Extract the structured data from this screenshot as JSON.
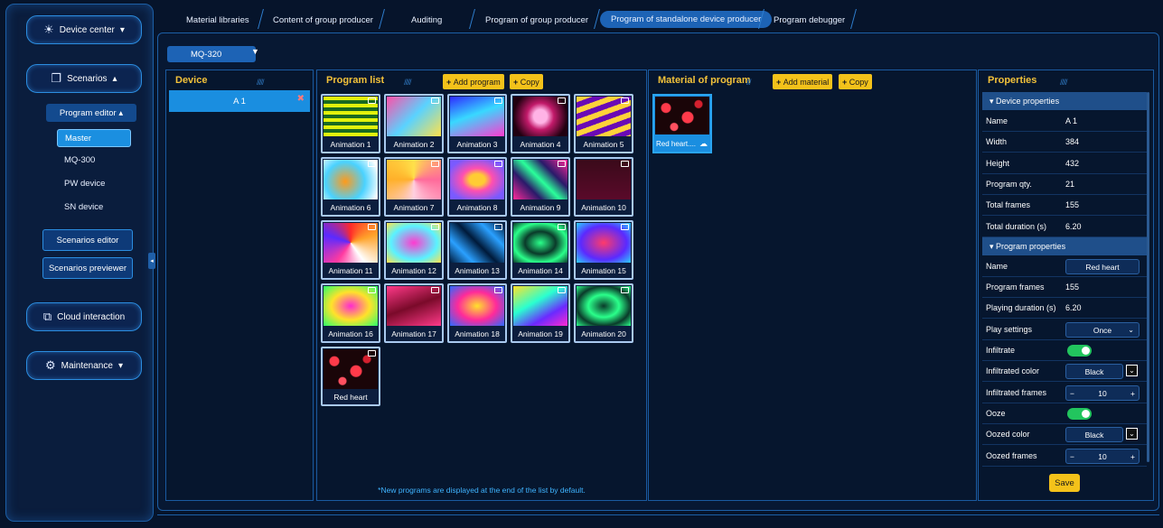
{
  "sidebar": {
    "device_center": "Device center",
    "scenarios": "Scenarios",
    "program_editor": "Program editor",
    "items": [
      "Master",
      "MQ-300",
      "PW device",
      "SN device"
    ],
    "scenarios_editor": "Scenarios editor",
    "scenarios_previewer": "Scenarios previewer",
    "cloud_interaction": "Cloud interaction",
    "maintenance": "Maintenance"
  },
  "tabs": [
    "Material libraries",
    "Content of group producer",
    "Auditing",
    "Program of group producer",
    "Program of standalone device producer",
    "Program debugger"
  ],
  "device_select": "MQ-320",
  "device_panel": {
    "title": "Device",
    "device_name": "A 1"
  },
  "program_list": {
    "title": "Program list",
    "add_label": "Add program",
    "copy_label": "Copy",
    "items": [
      "Animation 1",
      "Animation 2",
      "Animation 3",
      "Animation 4",
      "Animation 5",
      "Animation 6",
      "Animation 7",
      "Animation 8",
      "Animation 9",
      "Animation 10",
      "Animation 11",
      "Animation 12",
      "Animation 13",
      "Animation 14",
      "Animation 15",
      "Animation 16",
      "Animation 17",
      "Animation 18",
      "Animation 19",
      "Animation 20",
      "Red heart"
    ],
    "note": "*New programs are displayed at the end of the list by default."
  },
  "material": {
    "title": "Material of program",
    "add_label": "Add material",
    "copy_label": "Copy",
    "item": "Red heart...."
  },
  "properties": {
    "title": "Properties",
    "device_section": "Device properties",
    "device_rows": [
      [
        "Name",
        "A 1"
      ],
      [
        "Width",
        "384"
      ],
      [
        "Height",
        "432"
      ],
      [
        "Program qty.",
        "21"
      ],
      [
        "Total frames",
        "155"
      ],
      [
        "Total duration (s)",
        "6.20"
      ]
    ],
    "program_section": "Program properties",
    "program_name_label": "Name",
    "program_name": "Red heart",
    "program_frames_label": "Program frames",
    "program_frames": "155",
    "playing_duration_label": "Playing duration (s)",
    "playing_duration": "6.20",
    "play_settings_label": "Play settings",
    "play_settings": "Once",
    "infiltrate_label": "Infiltrate",
    "infiltrated_color_label": "Infiltrated color",
    "infiltrated_color": "Black",
    "infiltrated_frames_label": "Infiltrated frames",
    "infiltrated_frames": "10",
    "ooze_label": "Ooze",
    "oozed_color_label": "Oozed color",
    "oozed_color": "Black",
    "oozed_frames_label": "Oozed frames",
    "oozed_frames": "10",
    "save_label": "Save"
  }
}
